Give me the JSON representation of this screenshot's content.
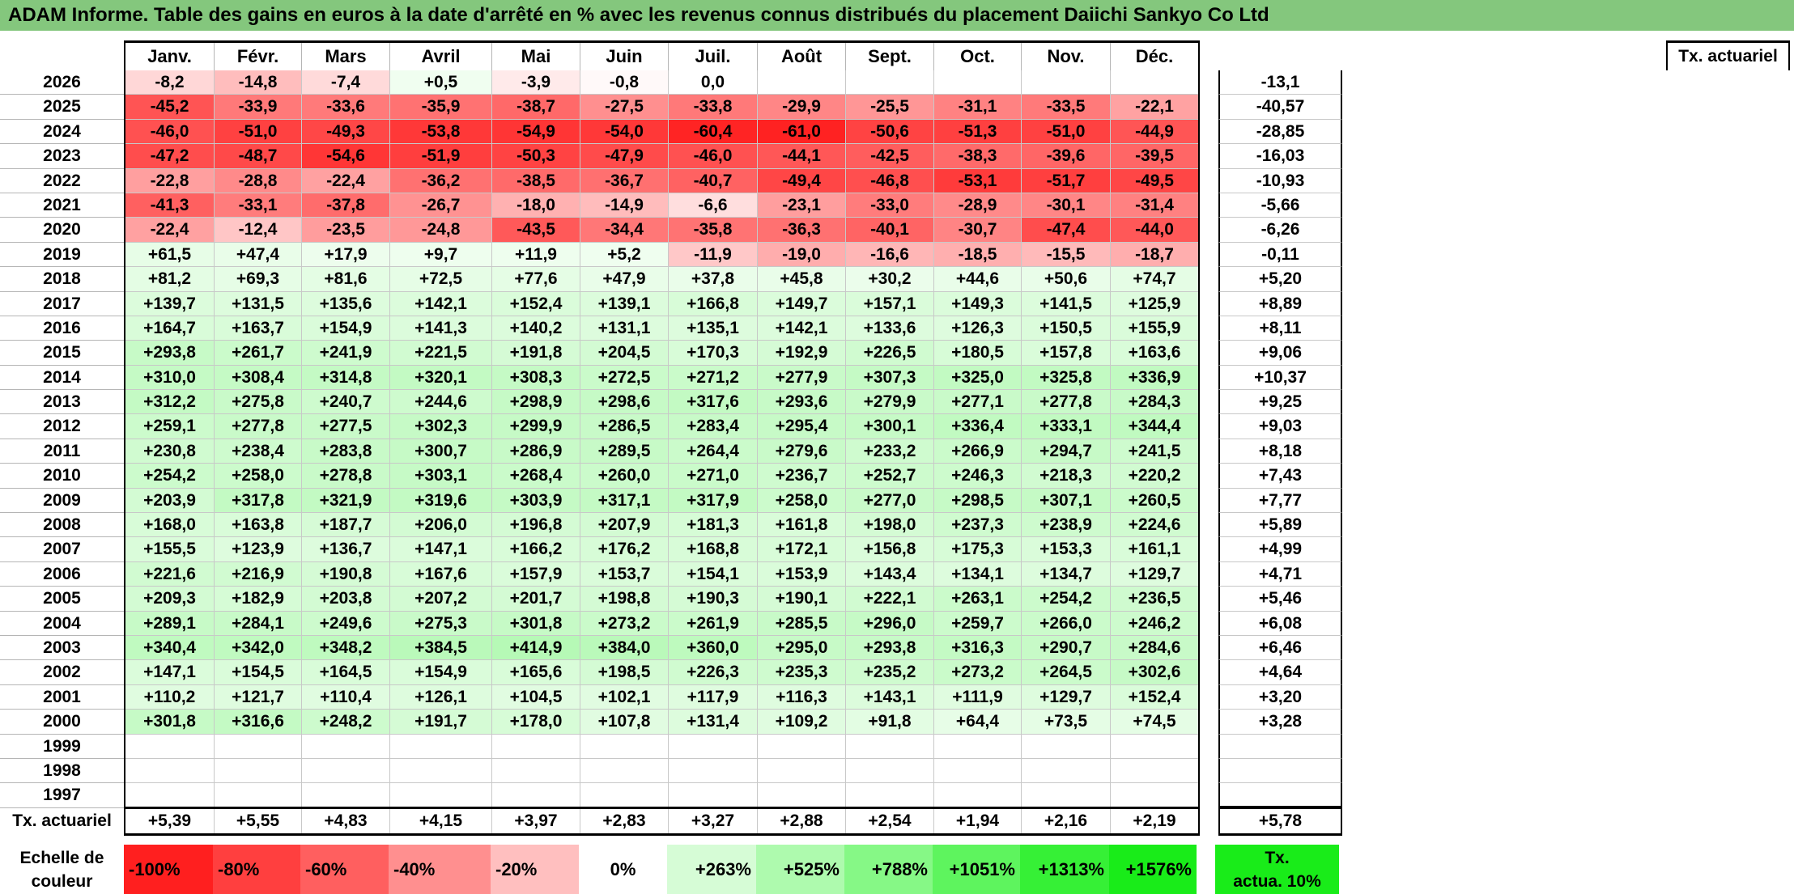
{
  "title": "ADAM Informe. Table des gains en euros à la date d'arrêté en % avec les revenus connus distribués du placement Daiichi Sankyo Co Ltd",
  "months": [
    "Janv.",
    "Févr.",
    "Mars",
    "Avril",
    "Mai",
    "Juin",
    "Juil.",
    "Août",
    "Sept.",
    "Oct.",
    "Nov.",
    "Déc."
  ],
  "tx_header": "Tx. actuariel",
  "rows": [
    {
      "year": "2026",
      "values": [
        "-8,2",
        "-14,8",
        "-7,4",
        "+0,5",
        "-3,9",
        "-0,8",
        "0,0",
        "",
        "",
        "",
        "",
        ""
      ],
      "tx": "-13,1"
    },
    {
      "year": "2025",
      "values": [
        "-45,2",
        "-33,9",
        "-33,6",
        "-35,9",
        "-38,7",
        "-27,5",
        "-33,8",
        "-29,9",
        "-25,5",
        "-31,1",
        "-33,5",
        "-22,1"
      ],
      "tx": "-40,57"
    },
    {
      "year": "2024",
      "values": [
        "-46,0",
        "-51,0",
        "-49,3",
        "-53,8",
        "-54,9",
        "-54,0",
        "-60,4",
        "-61,0",
        "-50,6",
        "-51,3",
        "-51,0",
        "-44,9"
      ],
      "tx": "-28,85"
    },
    {
      "year": "2023",
      "values": [
        "-47,2",
        "-48,7",
        "-54,6",
        "-51,9",
        "-50,3",
        "-47,9",
        "-46,0",
        "-44,1",
        "-42,5",
        "-38,3",
        "-39,6",
        "-39,5"
      ],
      "tx": "-16,03"
    },
    {
      "year": "2022",
      "values": [
        "-22,8",
        "-28,8",
        "-22,4",
        "-36,2",
        "-38,5",
        "-36,7",
        "-40,7",
        "-49,4",
        "-46,8",
        "-53,1",
        "-51,7",
        "-49,5"
      ],
      "tx": "-10,93"
    },
    {
      "year": "2021",
      "values": [
        "-41,3",
        "-33,1",
        "-37,8",
        "-26,7",
        "-18,0",
        "-14,9",
        "-6,6",
        "-23,1",
        "-33,0",
        "-28,9",
        "-30,1",
        "-31,4"
      ],
      "tx": "-5,66"
    },
    {
      "year": "2020",
      "values": [
        "-22,4",
        "-12,4",
        "-23,5",
        "-24,8",
        "-43,5",
        "-34,4",
        "-35,8",
        "-36,3",
        "-40,1",
        "-30,7",
        "-47,4",
        "-44,0"
      ],
      "tx": "-6,26"
    },
    {
      "year": "2019",
      "values": [
        "+61,5",
        "+47,4",
        "+17,9",
        "+9,7",
        "+11,9",
        "+5,2",
        "-11,9",
        "-19,0",
        "-16,6",
        "-18,5",
        "-15,5",
        "-18,7"
      ],
      "tx": "-0,11"
    },
    {
      "year": "2018",
      "values": [
        "+81,2",
        "+69,3",
        "+81,6",
        "+72,5",
        "+77,6",
        "+47,9",
        "+37,8",
        "+45,8",
        "+30,2",
        "+44,6",
        "+50,6",
        "+74,7"
      ],
      "tx": "+5,20"
    },
    {
      "year": "2017",
      "values": [
        "+139,7",
        "+131,5",
        "+135,6",
        "+142,1",
        "+152,4",
        "+139,1",
        "+166,8",
        "+149,7",
        "+157,1",
        "+149,3",
        "+141,5",
        "+125,9"
      ],
      "tx": "+8,89"
    },
    {
      "year": "2016",
      "values": [
        "+164,7",
        "+163,7",
        "+154,9",
        "+141,3",
        "+140,2",
        "+131,1",
        "+135,1",
        "+142,1",
        "+133,6",
        "+126,3",
        "+150,5",
        "+155,9"
      ],
      "tx": "+8,11"
    },
    {
      "year": "2015",
      "values": [
        "+293,8",
        "+261,7",
        "+241,9",
        "+221,5",
        "+191,8",
        "+204,5",
        "+170,3",
        "+192,9",
        "+226,5",
        "+180,5",
        "+157,8",
        "+163,6"
      ],
      "tx": "+9,06"
    },
    {
      "year": "2014",
      "values": [
        "+310,0",
        "+308,4",
        "+314,8",
        "+320,1",
        "+308,3",
        "+272,5",
        "+271,2",
        "+277,9",
        "+307,3",
        "+325,0",
        "+325,8",
        "+336,9"
      ],
      "tx": "+10,37"
    },
    {
      "year": "2013",
      "values": [
        "+312,2",
        "+275,8",
        "+240,7",
        "+244,6",
        "+298,9",
        "+298,6",
        "+317,6",
        "+293,6",
        "+279,9",
        "+277,1",
        "+277,8",
        "+284,3"
      ],
      "tx": "+9,25"
    },
    {
      "year": "2012",
      "values": [
        "+259,1",
        "+277,8",
        "+277,5",
        "+302,3",
        "+299,9",
        "+286,5",
        "+283,4",
        "+295,4",
        "+300,1",
        "+336,4",
        "+333,1",
        "+344,4"
      ],
      "tx": "+9,03"
    },
    {
      "year": "2011",
      "values": [
        "+230,8",
        "+238,4",
        "+283,8",
        "+300,7",
        "+286,9",
        "+289,5",
        "+264,4",
        "+279,6",
        "+233,2",
        "+266,9",
        "+294,7",
        "+241,5"
      ],
      "tx": "+8,18"
    },
    {
      "year": "2010",
      "values": [
        "+254,2",
        "+258,0",
        "+278,8",
        "+303,1",
        "+268,4",
        "+260,0",
        "+271,0",
        "+236,7",
        "+252,7",
        "+246,3",
        "+218,3",
        "+220,2"
      ],
      "tx": "+7,43"
    },
    {
      "year": "2009",
      "values": [
        "+203,9",
        "+317,8",
        "+321,9",
        "+319,6",
        "+303,9",
        "+317,1",
        "+317,9",
        "+258,0",
        "+277,0",
        "+298,5",
        "+307,1",
        "+260,5"
      ],
      "tx": "+7,77"
    },
    {
      "year": "2008",
      "values": [
        "+168,0",
        "+163,8",
        "+187,7",
        "+206,0",
        "+196,8",
        "+207,9",
        "+181,3",
        "+161,8",
        "+198,0",
        "+237,3",
        "+238,9",
        "+224,6"
      ],
      "tx": "+5,89"
    },
    {
      "year": "2007",
      "values": [
        "+155,5",
        "+123,9",
        "+136,7",
        "+147,1",
        "+166,2",
        "+176,2",
        "+168,8",
        "+172,1",
        "+156,8",
        "+175,3",
        "+153,3",
        "+161,1"
      ],
      "tx": "+4,99"
    },
    {
      "year": "2006",
      "values": [
        "+221,6",
        "+216,9",
        "+190,8",
        "+167,6",
        "+157,9",
        "+153,7",
        "+154,1",
        "+153,9",
        "+143,4",
        "+134,1",
        "+134,7",
        "+129,7"
      ],
      "tx": "+4,71"
    },
    {
      "year": "2005",
      "values": [
        "+209,3",
        "+182,9",
        "+203,8",
        "+207,2",
        "+201,7",
        "+198,8",
        "+190,3",
        "+190,1",
        "+222,1",
        "+263,1",
        "+254,2",
        "+236,5"
      ],
      "tx": "+5,46"
    },
    {
      "year": "2004",
      "values": [
        "+289,1",
        "+284,1",
        "+249,6",
        "+275,3",
        "+301,8",
        "+273,2",
        "+261,9",
        "+285,5",
        "+296,0",
        "+259,7",
        "+266,0",
        "+246,2"
      ],
      "tx": "+6,08"
    },
    {
      "year": "2003",
      "values": [
        "+340,4",
        "+342,0",
        "+348,2",
        "+384,5",
        "+414,9",
        "+384,0",
        "+360,0",
        "+295,0",
        "+293,8",
        "+316,3",
        "+290,7",
        "+284,6"
      ],
      "tx": "+6,46"
    },
    {
      "year": "2002",
      "values": [
        "+147,1",
        "+154,5",
        "+164,5",
        "+154,9",
        "+165,6",
        "+198,5",
        "+226,3",
        "+235,3",
        "+235,2",
        "+273,2",
        "+264,5",
        "+302,6"
      ],
      "tx": "+4,64"
    },
    {
      "year": "2001",
      "values": [
        "+110,2",
        "+121,7",
        "+110,4",
        "+126,1",
        "+104,5",
        "+102,1",
        "+117,9",
        "+116,3",
        "+143,1",
        "+111,9",
        "+129,7",
        "+152,4"
      ],
      "tx": "+3,20"
    },
    {
      "year": "2000",
      "values": [
        "+301,8",
        "+316,6",
        "+248,2",
        "+191,7",
        "+178,0",
        "+107,8",
        "+131,4",
        "+109,2",
        "+91,8",
        "+64,4",
        "+73,5",
        "+74,5"
      ],
      "tx": "+3,28"
    },
    {
      "year": "1999",
      "values": [
        "",
        "",
        "",
        "",
        "",
        "",
        "",
        "",
        "",
        "",
        "",
        ""
      ],
      "tx": ""
    },
    {
      "year": "1998",
      "values": [
        "",
        "",
        "",
        "",
        "",
        "",
        "",
        "",
        "",
        "",
        "",
        ""
      ],
      "tx": ""
    },
    {
      "year": "1997",
      "values": [
        "",
        "",
        "",
        "",
        "",
        "",
        "",
        "",
        "",
        "",
        "",
        ""
      ],
      "tx": ""
    }
  ],
  "footer": {
    "label": "Tx. actuariel",
    "values": [
      "+5,39",
      "+5,55",
      "+4,83",
      "+4,15",
      "+3,97",
      "+2,83",
      "+3,27",
      "+2,88",
      "+2,54",
      "+1,94",
      "+2,16",
      "+2,19"
    ],
    "tx": "+5,78"
  },
  "legend": {
    "label_line1": "Echelle de",
    "label_line2": "couleur",
    "items": [
      {
        "label": "-100%",
        "color": "#ff1f1f",
        "align": "left"
      },
      {
        "label": "-80%",
        "color": "#ff3f3f",
        "align": "left"
      },
      {
        "label": "-60%",
        "color": "#ff5f5f",
        "align": "left"
      },
      {
        "label": "-40%",
        "color": "#ff8f8f",
        "align": "left"
      },
      {
        "label": "-20%",
        "color": "#ffbfbf",
        "align": "left"
      },
      {
        "label": "0%",
        "color": "#ffffff",
        "align": "center"
      },
      {
        "label": "+263%",
        "color": "#d6fcd6",
        "align": "right"
      },
      {
        "label": "+525%",
        "color": "#aefaae",
        "align": "right"
      },
      {
        "label": "+788%",
        "color": "#86f886",
        "align": "right"
      },
      {
        "label": "+1051%",
        "color": "#5ef45e",
        "align": "right"
      },
      {
        "label": "+1313%",
        "color": "#36f036",
        "align": "right"
      },
      {
        "label": "+1576%",
        "color": "#19ec19",
        "align": "right"
      }
    ],
    "tx_line1": "Tx.",
    "tx_line2": "actua. 10%",
    "tx_color": "#19ec19"
  },
  "colors": {
    "title_bg": "#84c77d",
    "neg_max": "#ff1f1f",
    "pos_light": "#f4fef4",
    "pos_max": "#19ec19"
  }
}
